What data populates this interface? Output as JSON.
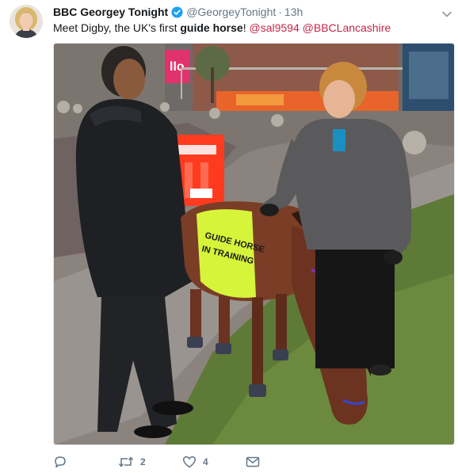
{
  "tweet": {
    "author_name": "BBC Georgey Tonight",
    "author_handle": "@GeorgeyTonight",
    "separator": "·",
    "time": "13h",
    "text_prefix": "Meet Digby, the UK's first ",
    "text_bold": "guide horse",
    "text_suffix": "! ",
    "mention_1": "@sal9594",
    "mention_2": "@BBCLancashire"
  },
  "photo": {
    "sign_text": "llo",
    "vest_line_1": "GUIDE HORSE",
    "vest_line_2": "IN TRAINING"
  },
  "actions": {
    "reply_count": "",
    "retweet_count": "2",
    "like_count": "4"
  },
  "icons": [
    "verified-badge-icon",
    "chevron-down-icon",
    "reply-icon",
    "retweet-icon",
    "heart-icon",
    "envelope-icon"
  ],
  "colors": {
    "mention": "#c5254a",
    "verified": "#1da1f2",
    "meta": "#657786",
    "vest": "#d6f53a",
    "barrier": "#ff3b1f"
  }
}
